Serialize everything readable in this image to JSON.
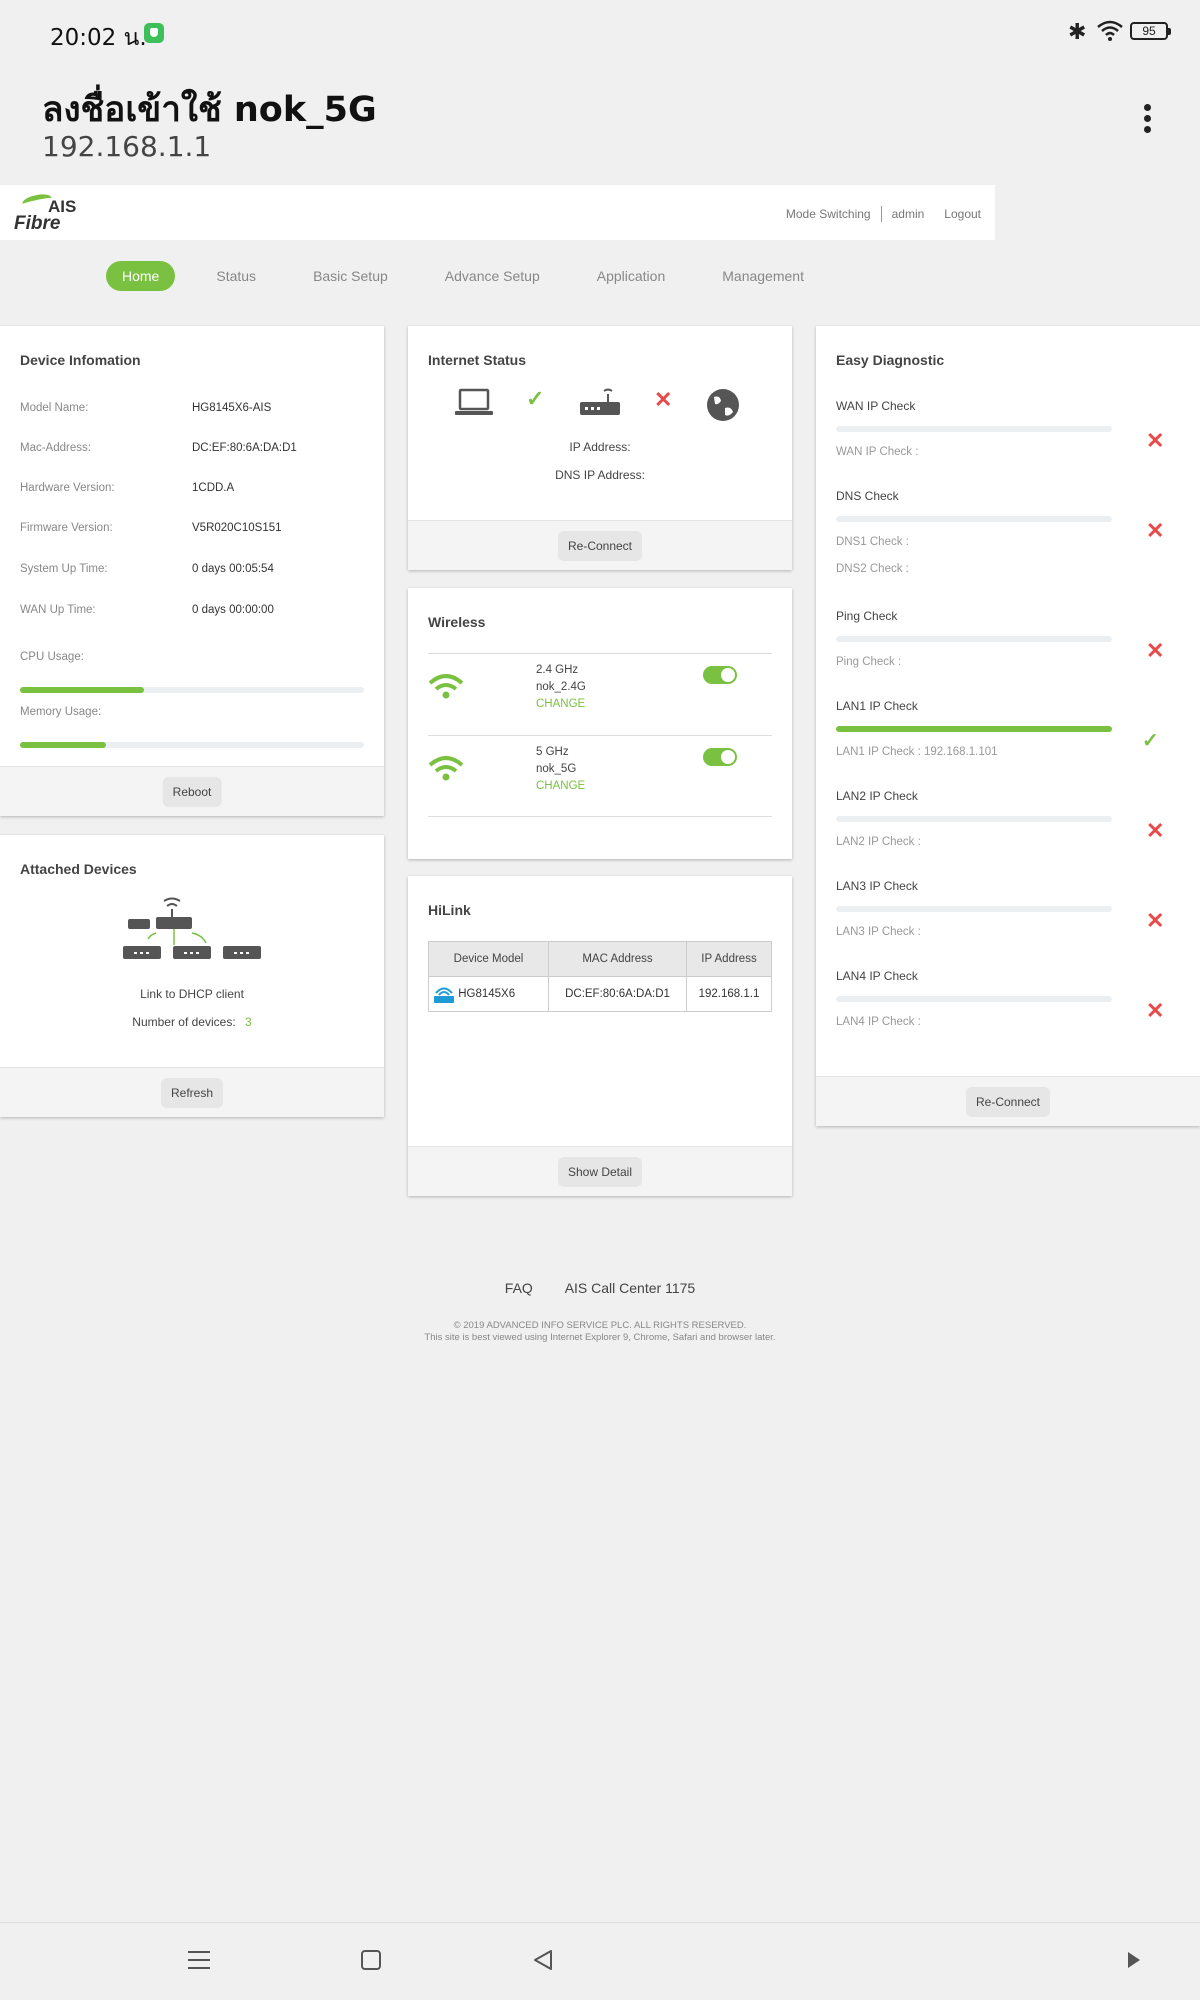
{
  "statusbar": {
    "time": "20:02 น.",
    "battery": "95"
  },
  "browser": {
    "title": "ลงชื่อเข้าใช้ nok_5G",
    "url": "192.168.1.1"
  },
  "brand": {
    "line1": "AIS",
    "line2": "Fibre",
    "accent": "#7ac142"
  },
  "toplinks": {
    "mode": "Mode Switching",
    "user": "admin",
    "logout": "Logout"
  },
  "nav": [
    "Home",
    "Status",
    "Basic Setup",
    "Advance Setup",
    "Application",
    "Management"
  ],
  "device_info": {
    "title": "Device Infomation",
    "rows": [
      {
        "label": "Model Name:",
        "value": "HG8145X6-AIS"
      },
      {
        "label": "Mac-Address:",
        "value": "DC:EF:80:6A:DA:D1"
      },
      {
        "label": "Hardware Version:",
        "value": "1CDD.A"
      },
      {
        "label": "Firmware Version:",
        "value": "V5R020C10S151"
      },
      {
        "label": "System Up Time:",
        "value": "0 days 00:05:54"
      },
      {
        "label": "WAN Up Time:",
        "value": "0 days 00:00:00"
      }
    ],
    "cpu_label": "CPU Usage:",
    "cpu_usage": 0.36,
    "mem_label": "Memory Usage:",
    "mem_usage": 0.25,
    "button": "Reboot"
  },
  "attached": {
    "title": "Attached Devices",
    "link": "Link to DHCP client",
    "count_label": "Number of devices:",
    "count": "3",
    "button": "Refresh"
  },
  "internet": {
    "title": "Internet Status",
    "ip_label": "IP Address:",
    "dns_label": "DNS IP Address:",
    "button": "Re-Connect"
  },
  "wireless": {
    "title": "Wireless",
    "bands": [
      {
        "band": "2.4 GHz",
        "ssid": "nok_2.4G",
        "action": "CHANGE"
      },
      {
        "band": "5 GHz",
        "ssid": "nok_5G",
        "action": "CHANGE"
      }
    ]
  },
  "hilink": {
    "title": "HiLink",
    "columns": [
      "Device Model",
      "MAC Address",
      "IP Address"
    ],
    "row": [
      "HG8145X6",
      "DC:EF:80:6A:DA:D1",
      "192.168.1.1"
    ],
    "button": "Show Detail"
  },
  "diagnostic": {
    "title": "Easy Diagnostic",
    "checks": [
      {
        "name": "WAN IP Check",
        "subs": [
          "WAN IP Check :"
        ]
      },
      {
        "name": "DNS Check",
        "subs": [
          "DNS1 Check :",
          "DNS2 Check :"
        ]
      },
      {
        "name": "Ping Check",
        "subs": [
          "Ping Check :"
        ]
      },
      {
        "name": "LAN1 IP Check",
        "subs": [
          "LAN1 IP Check : 192.168.1.101"
        ]
      },
      {
        "name": "LAN2 IP Check",
        "subs": [
          "LAN2 IP Check :"
        ]
      },
      {
        "name": "LAN3 IP Check",
        "subs": [
          "LAN3 IP Check :"
        ]
      },
      {
        "name": "LAN4 IP Check",
        "subs": [
          "LAN4 IP Check :"
        ]
      }
    ],
    "button": "Re-Connect"
  },
  "footer": {
    "faq": "FAQ",
    "callcenter": "AIS Call Center 1175",
    "copyright": "© 2019 ADVANCED INFO SERVICE PLC. ALL RIGHTS RESERVED.",
    "browser_note": "This site is best viewed using Internet Explorer 9, Chrome, Safari and browser later."
  }
}
